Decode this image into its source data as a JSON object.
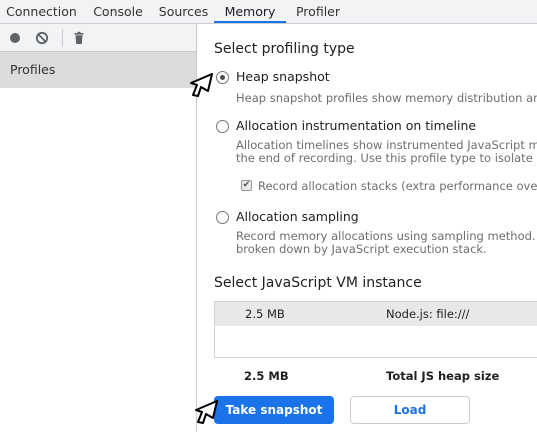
{
  "tabs": [
    "Connection",
    "Console",
    "Sources",
    "Memory",
    "Profiler"
  ],
  "active_tab": "Memory",
  "toolbar": {
    "record_icon": "record-icon",
    "clear_icon": "clear-icon",
    "delete_icon": "trash-icon"
  },
  "sidebar": {
    "profiles_label": "Profiles"
  },
  "profiling": {
    "heading": "Select profiling type",
    "options": [
      {
        "label": "Heap snapshot",
        "selected": true,
        "description": [
          "Heap snapshot profiles show memory distribution amon"
        ]
      },
      {
        "label": "Allocation instrumentation on timeline",
        "selected": false,
        "description": [
          "Allocation timelines show instrumented JavaScript mem",
          "the end of recording. Use this profile type to isolate me"
        ]
      },
      {
        "label": "Allocation sampling",
        "selected": false,
        "description": [
          "Record memory allocations using sampling method. This",
          "broken down by JavaScript execution stack."
        ]
      }
    ],
    "record_stacks": {
      "label": "Record allocation stacks (extra performance overhe",
      "checked": true
    }
  },
  "vm": {
    "heading": "Select JavaScript VM instance",
    "rows": [
      {
        "size": "2.5 MB",
        "name": "Node.js: file:///"
      }
    ],
    "total_size": "2.5 MB",
    "total_label": "Total JS heap size"
  },
  "buttons": {
    "take_snapshot": "Take snapshot",
    "load": "Load"
  },
  "colors": {
    "accent": "#1a73e8",
    "sidebar_selected": "#dcdcdc",
    "toolbar_bg": "#f1f3f4"
  }
}
